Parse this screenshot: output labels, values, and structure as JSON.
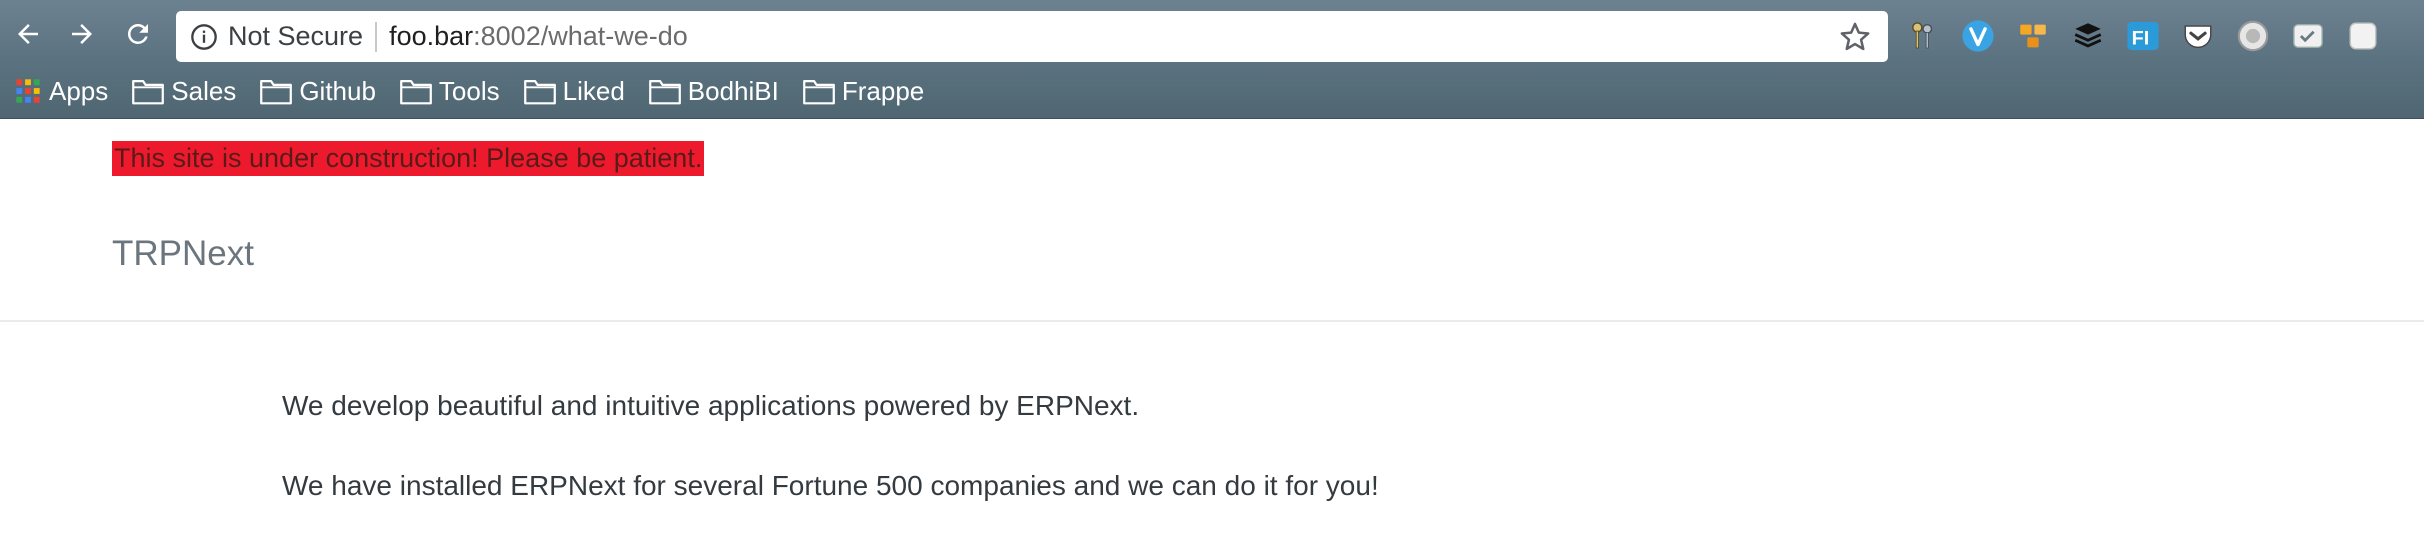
{
  "browser": {
    "omnibox": {
      "security_label": "Not Secure",
      "url_host": "foo.bar",
      "url_rest": ":8002/what-we-do"
    },
    "nav_icons": [
      "back-arrow-icon",
      "forward-arrow-icon",
      "reload-icon"
    ],
    "extensions": [
      "keys-extension",
      "v-extension",
      "honeycomb-extension",
      "buffer-extension",
      "fi-extension",
      "pocket-extension",
      "circle-extension",
      "todo-extension",
      "square-extension"
    ],
    "bookmarks": [
      {
        "label": "Apps",
        "icon": "apps-grid-icon"
      },
      {
        "label": "Sales",
        "icon": "folder-icon"
      },
      {
        "label": "Github",
        "icon": "folder-icon"
      },
      {
        "label": "Tools",
        "icon": "folder-icon"
      },
      {
        "label": "Liked",
        "icon": "folder-icon"
      },
      {
        "label": "BodhiBI",
        "icon": "folder-icon"
      },
      {
        "label": "Frappe",
        "icon": "folder-icon"
      }
    ]
  },
  "page": {
    "banner": "This site is under construction! Please be patient.",
    "brand": "TRPNext",
    "paragraphs": [
      "We develop beautiful and intuitive applications powered by ERPNext.",
      "We have installed ERPNext for several Fortune 500 companies and we can do it for you!"
    ]
  },
  "colors": {
    "chrome": "#5b7280",
    "banner_bg": "#ec1a2c",
    "brand_text": "#6c757d",
    "body_text": "#333a40"
  }
}
